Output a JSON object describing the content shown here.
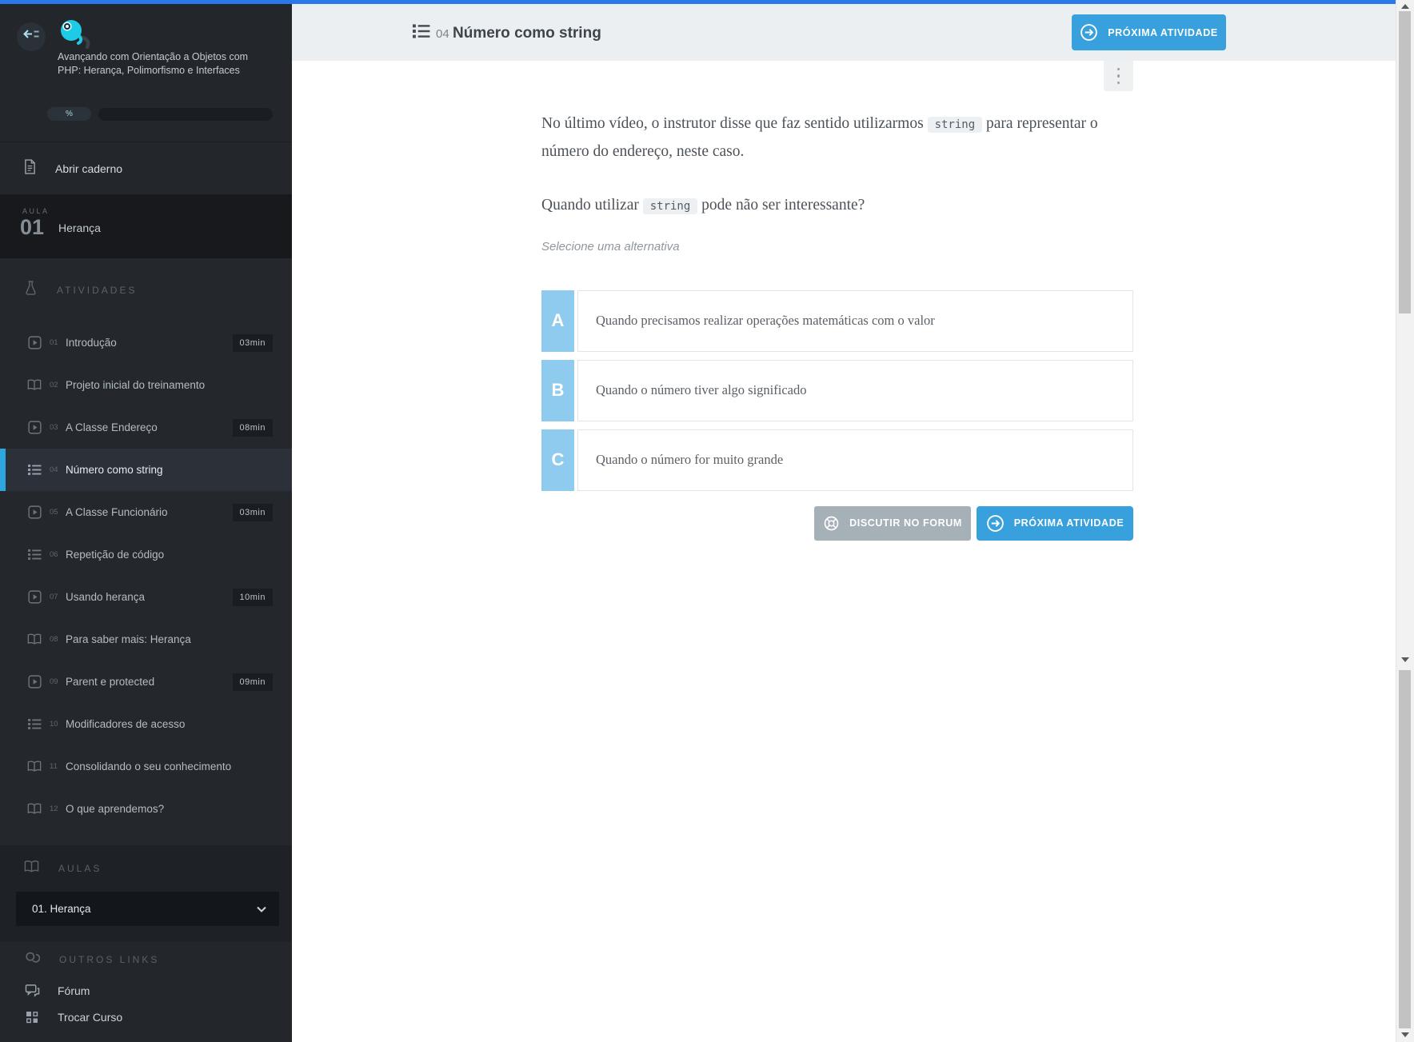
{
  "colors": {
    "top_line": "#2979e8",
    "sidebar_bg": "#23272c",
    "sidebar_active_bar": "#2da7e0",
    "accent_blue_button": "#38a0dc",
    "alternative_letter_bg": "#8fcbee",
    "gray_button": "#a6b0b7",
    "header_bg": "#eceff1",
    "mascot_cyan": "#1ecbe6"
  },
  "sidebar": {
    "course_title": "Avançando com Orientação a Objetos com PHP: Herança, Polimorfismo e Interfaces",
    "progress_label": "%",
    "notebook_label": "Abrir caderno",
    "lesson": {
      "kicker": "AULA",
      "number": "01",
      "title": "Herança"
    },
    "activities_header": "ATIVIDADES",
    "activities": [
      {
        "num": "01",
        "label": "Introdução",
        "icon": "video",
        "duration": "03min"
      },
      {
        "num": "02",
        "label": "Projeto inicial do treinamento",
        "icon": "book"
      },
      {
        "num": "03",
        "label": "A Classe Endereço",
        "icon": "video",
        "duration": "08min"
      },
      {
        "num": "04",
        "label": "Número como string",
        "icon": "list",
        "active": true
      },
      {
        "num": "05",
        "label": "A Classe Funcionário",
        "icon": "video",
        "duration": "03min"
      },
      {
        "num": "06",
        "label": "Repetição de código",
        "icon": "list"
      },
      {
        "num": "07",
        "label": "Usando herança",
        "icon": "video",
        "duration": "10min"
      },
      {
        "num": "08",
        "label": "Para saber mais: Herança",
        "icon": "book"
      },
      {
        "num": "09",
        "label": "Parent e protected",
        "icon": "video",
        "duration": "09min"
      },
      {
        "num": "10",
        "label": "Modificadores de acesso",
        "icon": "list"
      },
      {
        "num": "11",
        "label": "Consolidando o seu conhecimento",
        "icon": "book"
      },
      {
        "num": "12",
        "label": "O que aprendemos?",
        "icon": "book"
      }
    ],
    "aulas_header": "AULAS",
    "aulas_dropdown_value": "01. Herança",
    "links_header": "OUTROS LINKS",
    "links": [
      {
        "label": "Fórum",
        "icon": "chat"
      },
      {
        "label": "Trocar Curso",
        "icon": "grid"
      }
    ]
  },
  "header": {
    "number": "04",
    "title": "Número como string",
    "next_button": "PRÓXIMA ATIVIDADE"
  },
  "question": {
    "p1": {
      "before": "No último vídeo, o instrutor disse que faz sentido utilizarmos ",
      "code": "string",
      "after": " para representar o número do endereço, neste caso."
    },
    "p2": {
      "before": "Quando utilizar ",
      "code": "string",
      "after": " pode não ser interessante?"
    },
    "hint": "Selecione uma alternativa",
    "alternatives": [
      {
        "letter": "A",
        "text": "Quando precisamos realizar operações matemáticas com o valor"
      },
      {
        "letter": "B",
        "text": "Quando o número tiver algo significado"
      },
      {
        "letter": "C",
        "text": "Quando o número for muito grande"
      }
    ],
    "forum_button": "DISCUTIR NO FORUM",
    "next_button": "PRÓXIMA ATIVIDADE"
  }
}
